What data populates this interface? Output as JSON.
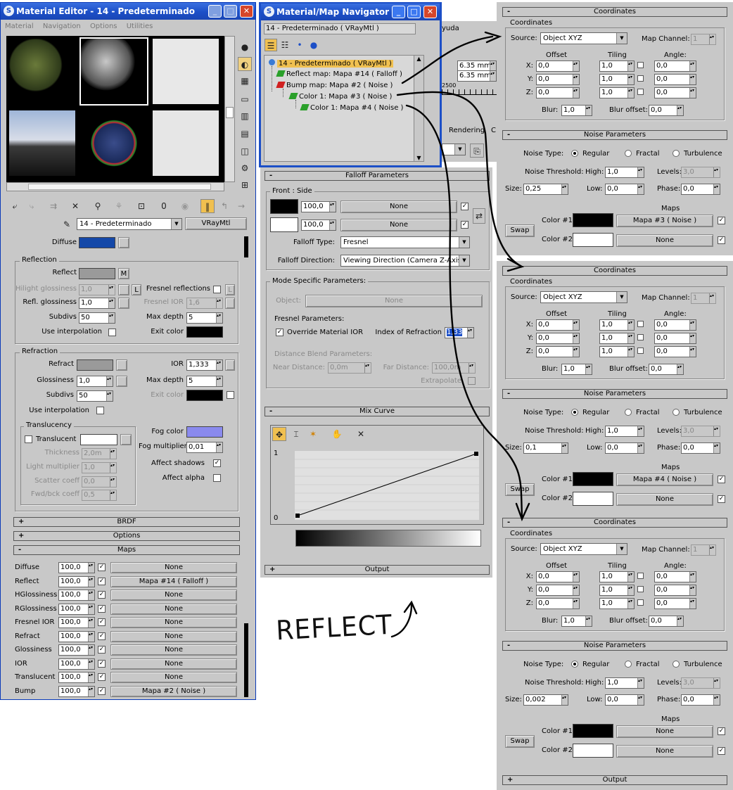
{
  "material_editor": {
    "title": "Material Editor - 14 - Predeterminado",
    "menu": [
      "Material",
      "Navigation",
      "Options",
      "Utilities"
    ],
    "material_name": "14 - Predeterminado",
    "material_type": "VRayMtl",
    "diffuse_label": "Diffuse",
    "reflection": {
      "group_title": "Reflection",
      "reflect_label": "Reflect",
      "reflect_map_btn": "M",
      "hilight_label": "Hilight glossiness",
      "hilight_value": "1,0",
      "lock_label": "L",
      "fresnel_label": "Fresnel reflections",
      "fresnel_lock": "L",
      "refl_gloss_label": "Refl. glossiness",
      "refl_gloss_value": "1,0",
      "fresnel_ior_label": "Fresnel IOR",
      "fresnel_ior_value": "1,6",
      "subdivs_label": "Subdivs",
      "subdivs_value": "50",
      "max_depth_label": "Max depth",
      "max_depth_value": "5",
      "use_interp_label": "Use interpolation",
      "exit_color_label": "Exit color"
    },
    "refraction": {
      "group_title": "Refraction",
      "refract_label": "Refract",
      "ior_label": "IOR",
      "ior_value": "1,333",
      "gloss_label": "Glossiness",
      "gloss_value": "1,0",
      "max_depth_label": "Max depth",
      "max_depth_value": "5",
      "subdivs_label": "Subdivs",
      "subdivs_value": "50",
      "exit_color_label": "Exit color",
      "use_interp_label": "Use interpolation",
      "fog_color_label": "Fog color",
      "fog_mult_label": "Fog multiplier",
      "fog_mult_value": "0,01",
      "affect_shadows_label": "Affect shadows",
      "affect_alpha_label": "Affect alpha"
    },
    "translucency": {
      "group_title": "Translucency",
      "translucent_label": "Translucent",
      "thickness_label": "Thickness",
      "thickness_value": "2,0m",
      "light_mult_label": "Light multiplier",
      "light_mult_value": "1,0",
      "scatter_label": "Scatter coeff",
      "scatter_value": "0,0",
      "fwd_label": "Fwd/bck coeff",
      "fwd_value": "0,5"
    },
    "rollouts": {
      "brdf": "BRDF",
      "options": "Options",
      "maps": "Maps"
    },
    "maps": [
      {
        "name": "Diffuse",
        "amount": "100,0",
        "map": "None"
      },
      {
        "name": "Reflect",
        "amount": "100,0",
        "map": "Mapa #14  ( Falloff )"
      },
      {
        "name": "HGlossiness",
        "amount": "100,0",
        "map": "None"
      },
      {
        "name": "RGlossiness",
        "amount": "100,0",
        "map": "None"
      },
      {
        "name": "Fresnel IOR",
        "amount": "100,0",
        "map": "None"
      },
      {
        "name": "Refract",
        "amount": "100,0",
        "map": "None"
      },
      {
        "name": "Glossiness",
        "amount": "100,0",
        "map": "None"
      },
      {
        "name": "IOR",
        "amount": "100,0",
        "map": "None"
      },
      {
        "name": "Translucent",
        "amount": "100,0",
        "map": "None"
      },
      {
        "name": "Bump",
        "amount": "100,0",
        "map": "Mapa #2  ( Noise )"
      }
    ],
    "toolbar_number": "0"
  },
  "navigator": {
    "title": "Material/Map Navigator",
    "header": "14 - Predeterminado  ( VRayMtl )",
    "tree": [
      {
        "label": "14 - Predeterminado  ( VRayMtl )",
        "color": "#3a7bd5"
      },
      {
        "label": "Reflect map: Mapa #14  ( Falloff )",
        "color": "#2aa02a"
      },
      {
        "label": "Bump map: Mapa #2  ( Noise )",
        "color": "#d02020"
      },
      {
        "label": "Color 1: Mapa #3  ( Noise )",
        "color": "#2aa02a"
      },
      {
        "label": "Color 1: Mapa #4  ( Noise )",
        "color": "#2aa02a"
      }
    ]
  },
  "background_app": {
    "menu_fragment": "yuda",
    "coord_x": "6.35 mm",
    "coord_y": "6.35 mm",
    "ruler_value": "2500",
    "rendering_label": "Rendering",
    "c_label": "C"
  },
  "falloff": {
    "rollout_title": "Falloff Parameters",
    "front_side_label": "Front : Side",
    "amount1": "100,0",
    "amount2": "100,0",
    "map1": "None",
    "map2": "None",
    "falloff_type_label": "Falloff Type:",
    "falloff_type": "Fresnel",
    "falloff_dir_label": "Falloff Direction:",
    "falloff_dir": "Viewing Direction (Camera Z-Axis)",
    "mode_label": "Mode Specific Parameters:",
    "object_label": "Object:",
    "object_value": "None",
    "fresnel_params_label": "Fresnel Parameters:",
    "override_ior_label": "Override Material IOR",
    "ior_label": "Index of Refraction",
    "ior_value": "1,33",
    "distance_label": "Distance Blend Parameters:",
    "near_label": "Near Distance:",
    "near_value": "0,0m",
    "far_label": "Far Distance:",
    "far_value": "100,0m",
    "extrapolate_label": "Extrapolate",
    "mix_curve_title": "Mix Curve",
    "curve_top": "1",
    "curve_bottom": "0",
    "output_title": "Output"
  },
  "noise_panels": [
    {
      "coords_title": "Coordinates",
      "coords_group": "Coordinates",
      "source_label": "Source:",
      "source": "Object XYZ",
      "channel_label": "Map Channel:",
      "channel": "1",
      "offset_label": "Offset",
      "tiling_label": "Tiling",
      "angle_label": "Angle:",
      "offset": [
        "0,0",
        "0,0",
        "0,0"
      ],
      "tiling": [
        "1,0",
        "1,0",
        "1,0"
      ],
      "angle": [
        "0,0",
        "0,0",
        "0,0"
      ],
      "blur_label": "Blur:",
      "blur": "1,0",
      "blur_offset_label": "Blur offset:",
      "blur_offset": "0,0",
      "noise_title": "Noise Parameters",
      "noise_type_label": "Noise Type:",
      "regular": "Regular",
      "fractal": "Fractal",
      "turbulence": "Turbulence",
      "threshold_label": "Noise Threshold:",
      "high_label": "High:",
      "high": "1,0",
      "levels_label": "Levels:",
      "levels": "3,0",
      "size_label": "Size:",
      "size": "0,25",
      "low_label": "Low:",
      "low": "0,0",
      "phase_label": "Phase:",
      "phase": "0,0",
      "maps_label": "Maps",
      "swap": "Swap",
      "color1_label": "Color #1",
      "color1_map": "Mapa #3  ( Noise )",
      "color2_label": "Color #2",
      "color2_map": "None"
    },
    {
      "coords_title": "Coordinates",
      "coords_group": "Coordinates",
      "source_label": "Source:",
      "source": "Object XYZ",
      "channel_label": "Map Channel:",
      "channel": "1",
      "offset_label": "Offset",
      "tiling_label": "Tiling",
      "angle_label": "Angle:",
      "offset": [
        "0,0",
        "0,0",
        "0,0"
      ],
      "tiling": [
        "1,0",
        "1,0",
        "1,0"
      ],
      "angle": [
        "0,0",
        "0,0",
        "0,0"
      ],
      "blur_label": "Blur:",
      "blur": "1,0",
      "blur_offset_label": "Blur offset:",
      "blur_offset": "0,0",
      "noise_title": "Noise Parameters",
      "noise_type_label": "Noise Type:",
      "regular": "Regular",
      "fractal": "Fractal",
      "turbulence": "Turbulence",
      "threshold_label": "Noise Threshold:",
      "high_label": "High:",
      "high": "1,0",
      "levels_label": "Levels:",
      "levels": "3,0",
      "size_label": "Size:",
      "size": "0,1",
      "low_label": "Low:",
      "low": "0,0",
      "phase_label": "Phase:",
      "phase": "0,0",
      "maps_label": "Maps",
      "swap": "Swap",
      "color1_label": "Color #1",
      "color1_map": "Mapa #4  ( Noise )",
      "color2_label": "Color #2",
      "color2_map": "None"
    },
    {
      "coords_title": "Coordinates",
      "coords_group": "Coordinates",
      "source_label": "Source:",
      "source": "Object XYZ",
      "channel_label": "Map Channel:",
      "channel": "1",
      "offset_label": "Offset",
      "tiling_label": "Tiling",
      "angle_label": "Angle:",
      "offset": [
        "0,0",
        "0,0",
        "0,0"
      ],
      "tiling": [
        "1,0",
        "1,0",
        "1,0"
      ],
      "angle": [
        "0,0",
        "0,0",
        "0,0"
      ],
      "blur_label": "Blur:",
      "blur": "1,0",
      "blur_offset_label": "Blur offset:",
      "blur_offset": "0,0",
      "noise_title": "Noise Parameters",
      "noise_type_label": "Noise Type:",
      "regular": "Regular",
      "fractal": "Fractal",
      "turbulence": "Turbulence",
      "threshold_label": "Noise Threshold:",
      "high_label": "High:",
      "high": "1,0",
      "levels_label": "Levels:",
      "levels": "3,0",
      "size_label": "Size:",
      "size": "0,002",
      "low_label": "Low:",
      "low": "0,0",
      "phase_label": "Phase:",
      "phase": "0,0",
      "maps_label": "Maps",
      "swap": "Swap",
      "color1_label": "Color #1",
      "color1_map": "None",
      "color2_label": "Color #2",
      "color2_map": "None"
    }
  ],
  "noise_output_title": "Output",
  "xyz_labels": [
    "X:",
    "Y:",
    "Z:"
  ],
  "handwritten_note": "REFLECT",
  "colors": {
    "title_blue": "#1c4fc7",
    "panel_gray": "#c8c8c8",
    "diffuse_swatch": "#1448a8",
    "reflect_swatch": "#9a9a9a",
    "fog_swatch": "#8a8aee"
  }
}
